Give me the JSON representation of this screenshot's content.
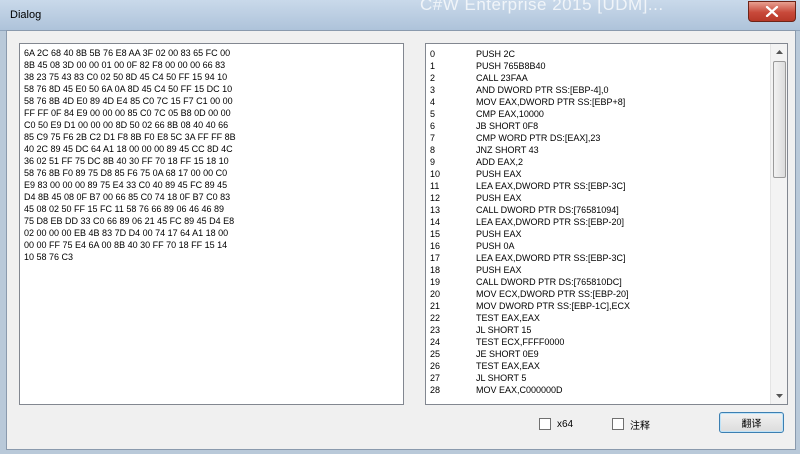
{
  "window": {
    "title": "Dialog",
    "background_text": "C#W Enterprise 2015 [UDM]...",
    "close_icon": "close-icon"
  },
  "hex_dump": {
    "lines": [
      "6A 2C 68 40 8B 5B 76 E8 AA 3F 02 00 83 65 FC 00",
      "8B 45 08 3D 00 00 01 00 0F 82 F8 00 00 00 66 83",
      "38 23 75 43 83 C0 02 50 8D 45 C4 50 FF 15 94 10",
      "58 76 8D 45 E0 50 6A 0A 8D 45 C4 50 FF 15 DC 10",
      "58 76 8B 4D E0 89 4D E4 85 C0 7C 15 F7 C1 00 00",
      "FF FF 0F 84 E9 00 00 00 85 C0 7C 05 B8 0D 00 00",
      "C0 50 E9 D1 00 00 00 8D 50 02 66 8B 08 40 40 66",
      "85 C9 75 F6 2B C2 D1 F8 8B F0 E8 5C 3A FF FF 8B",
      "40 2C 89 45 DC 64 A1 18 00 00 00 89 45 CC 8D 4C",
      "36 02 51 FF 75 DC 8B 40 30 FF 70 18 FF 15 18 10",
      "58 76 8B F0 89 75 D8 85 F6 75 0A 68 17 00 00 C0",
      "E9 83 00 00 00 89 75 E4 33 C0 40 89 45 FC 89 45",
      "D4 8B 45 08 0F B7 00 66 85 C0 74 18 0F B7 C0 83",
      "45 08 02 50 FF 15 FC 11 58 76 66 89 06 46 46 89",
      "75 D8 EB DD 33 C0 66 89 06 21 45 FC 89 45 D4 E8",
      "02 00 00 00 EB 4B 83 7D D4 00 74 17 64 A1 18 00",
      "00 00 FF 75 E4 6A 00 8B 40 30 FF 70 18 FF 15 14",
      "10 58 76 C3"
    ]
  },
  "disassembly": {
    "rows": [
      {
        "idx": "0",
        "ins": "PUSH 2C"
      },
      {
        "idx": "1",
        "ins": "PUSH 765B8B40"
      },
      {
        "idx": "2",
        "ins": "CALL 23FAA"
      },
      {
        "idx": "3",
        "ins": "AND DWORD PTR SS:[EBP-4],0"
      },
      {
        "idx": "4",
        "ins": "MOV EAX,DWORD PTR SS:[EBP+8]"
      },
      {
        "idx": "5",
        "ins": "CMP EAX,10000"
      },
      {
        "idx": "6",
        "ins": "JB SHORT 0F8"
      },
      {
        "idx": "7",
        "ins": "CMP WORD PTR DS:[EAX],23"
      },
      {
        "idx": "8",
        "ins": "JNZ SHORT 43"
      },
      {
        "idx": "9",
        "ins": "ADD EAX,2"
      },
      {
        "idx": "10",
        "ins": "PUSH EAX"
      },
      {
        "idx": "11",
        "ins": "LEA EAX,DWORD PTR SS:[EBP-3C]"
      },
      {
        "idx": "12",
        "ins": "PUSH EAX"
      },
      {
        "idx": "13",
        "ins": "CALL DWORD PTR DS:[76581094]"
      },
      {
        "idx": "14",
        "ins": "LEA EAX,DWORD PTR SS:[EBP-20]"
      },
      {
        "idx": "15",
        "ins": "PUSH EAX"
      },
      {
        "idx": "16",
        "ins": "PUSH 0A"
      },
      {
        "idx": "17",
        "ins": "LEA EAX,DWORD PTR SS:[EBP-3C]"
      },
      {
        "idx": "18",
        "ins": "PUSH EAX"
      },
      {
        "idx": "19",
        "ins": "CALL DWORD PTR DS:[765810DC]"
      },
      {
        "idx": "20",
        "ins": "MOV ECX,DWORD PTR SS:[EBP-20]"
      },
      {
        "idx": "21",
        "ins": "MOV DWORD PTR SS:[EBP-1C],ECX"
      },
      {
        "idx": "22",
        "ins": "TEST EAX,EAX"
      },
      {
        "idx": "23",
        "ins": "JL SHORT 15"
      },
      {
        "idx": "24",
        "ins": "TEST ECX,FFFF0000"
      },
      {
        "idx": "25",
        "ins": "JE SHORT 0E9"
      },
      {
        "idx": "26",
        "ins": "TEST EAX,EAX"
      },
      {
        "idx": "27",
        "ins": "JL SHORT 5"
      },
      {
        "idx": "28",
        "ins": "MOV EAX,C000000D"
      }
    ]
  },
  "options": {
    "x64_label": "x64",
    "x64_checked": false,
    "comment_label": "注释",
    "comment_checked": false
  },
  "actions": {
    "translate_label": "翻译"
  },
  "colors": {
    "titlebar": "#b9cde2",
    "close_button": "#c8493a",
    "button_focus": "#3c7fb1"
  }
}
